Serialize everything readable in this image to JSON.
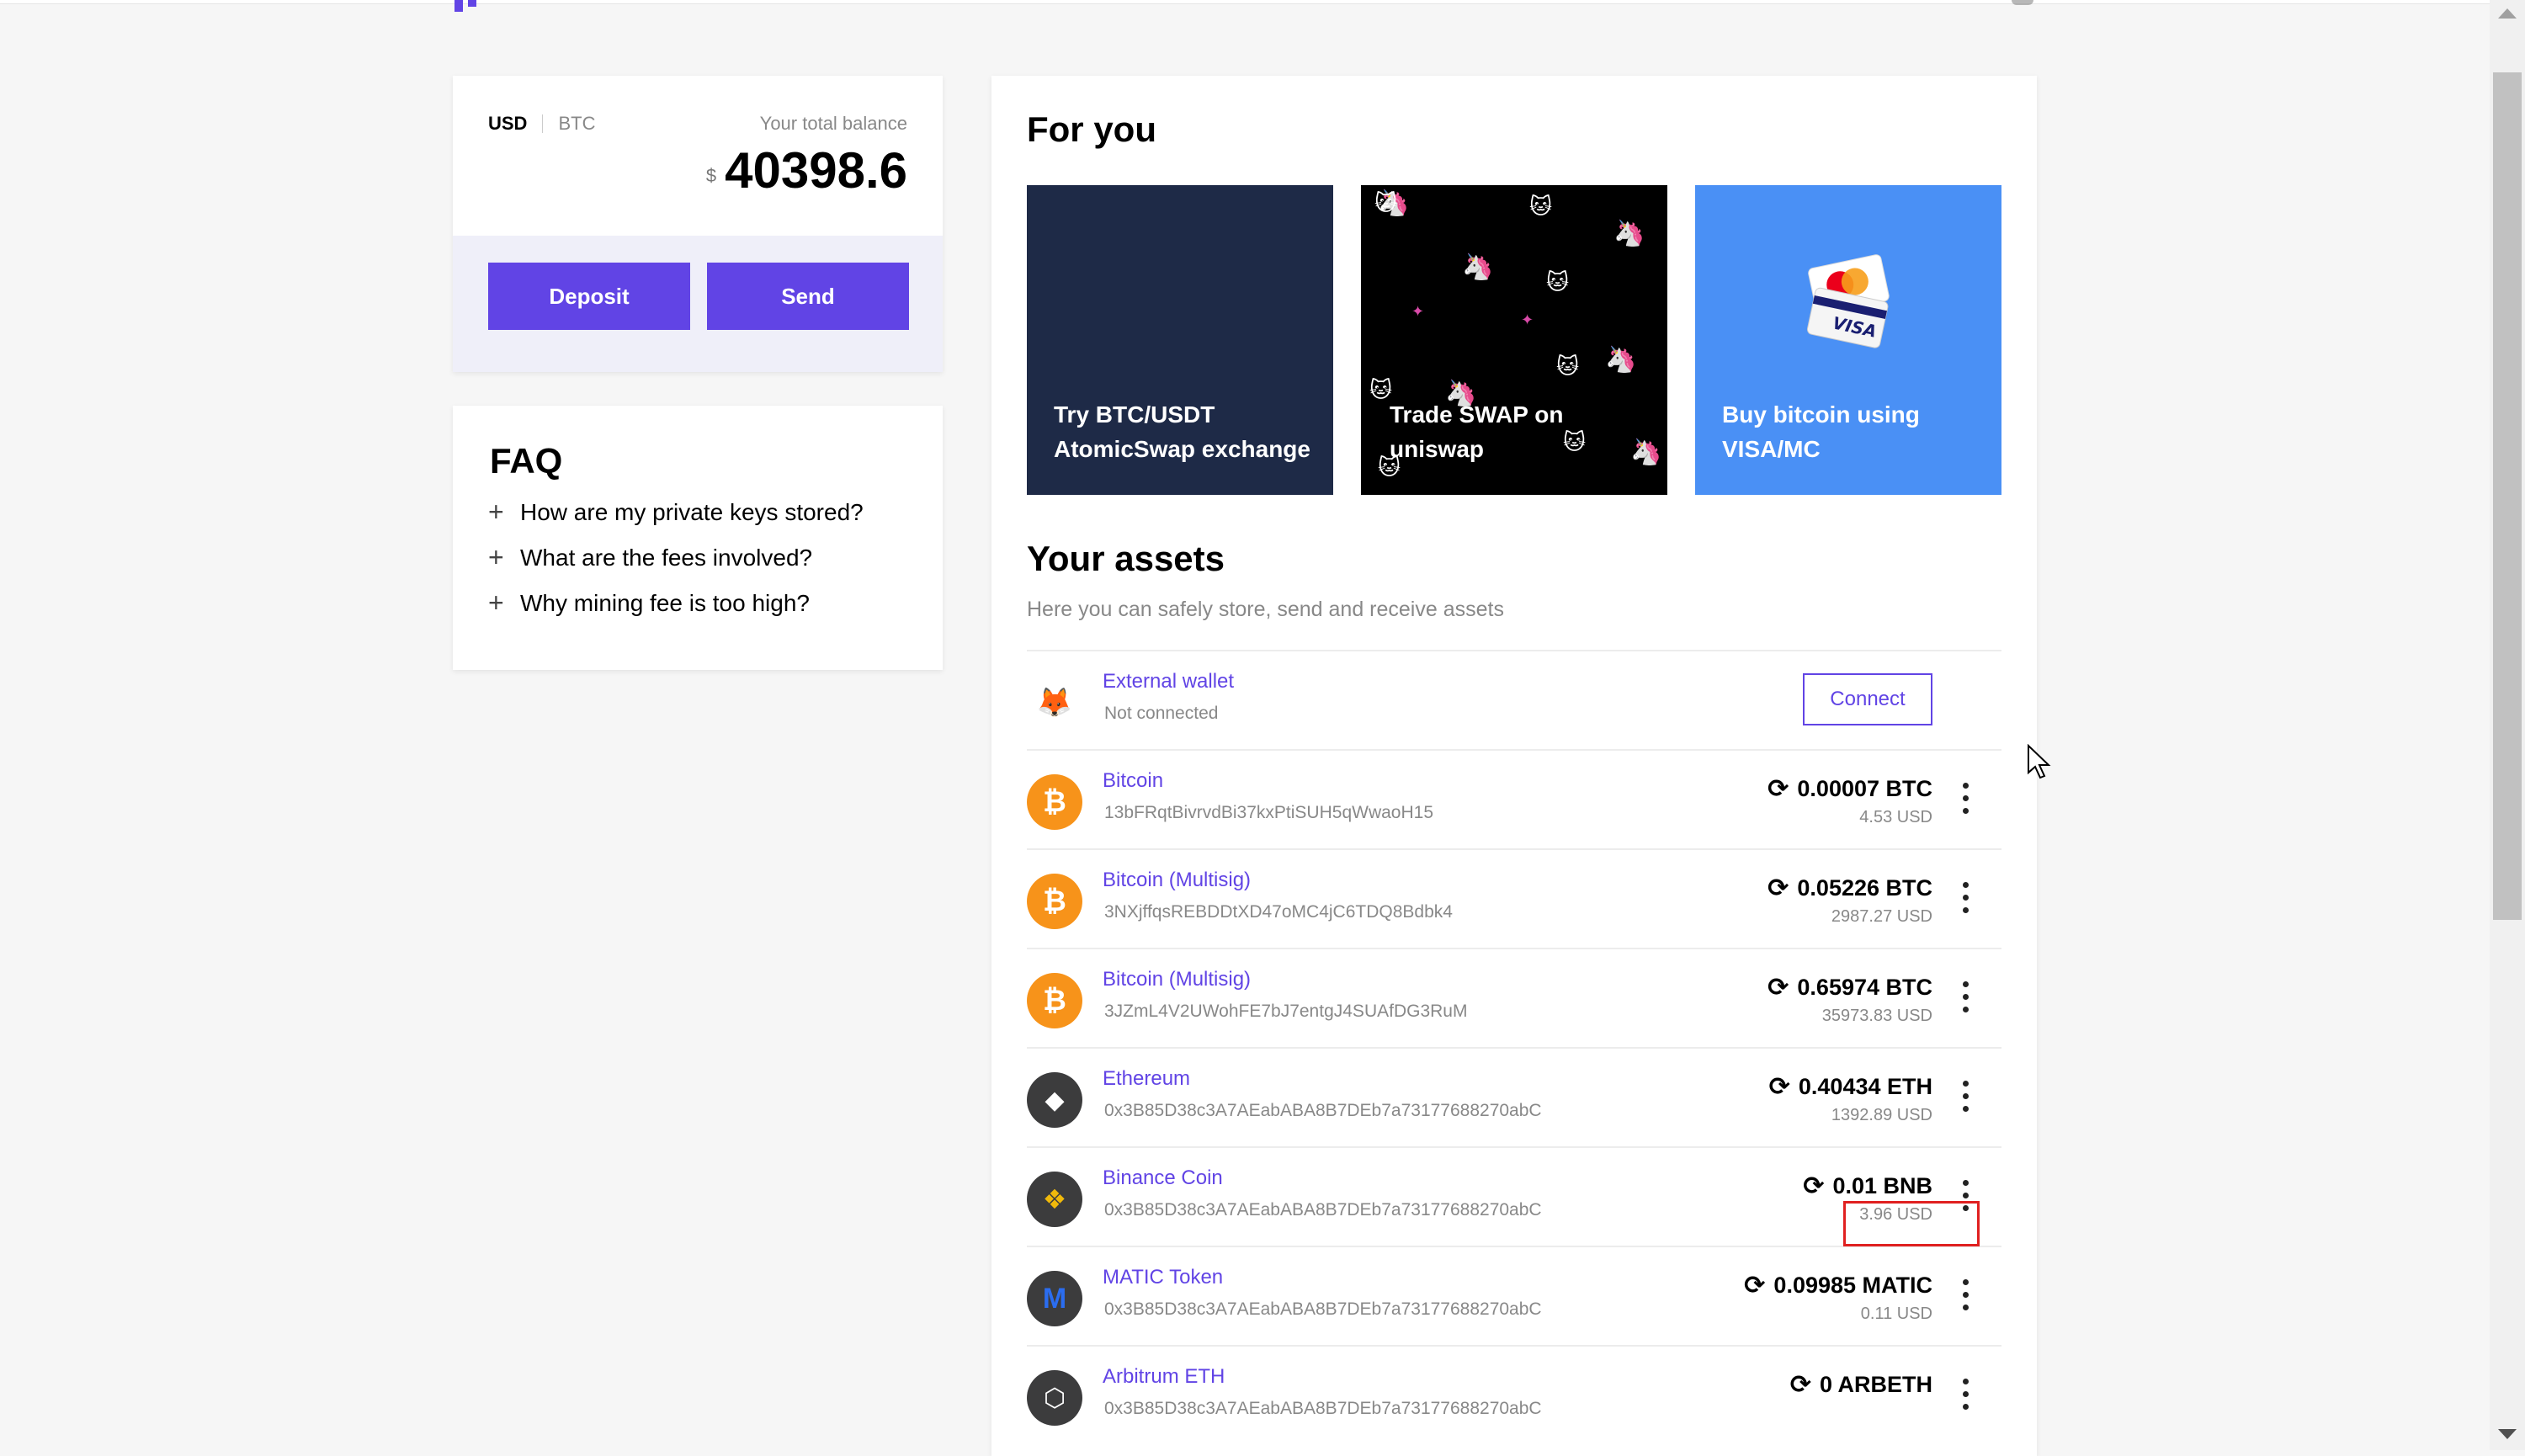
{
  "balance": {
    "currency_usd": "USD",
    "currency_btc": "BTC",
    "label": "Your total balance",
    "symbol": "$",
    "value": "40398.6",
    "deposit_label": "Deposit",
    "send_label": "Send"
  },
  "faq": {
    "title": "FAQ",
    "items": [
      "How are my private keys stored?",
      "What are the fees involved?",
      "Why mining fee is too high?"
    ]
  },
  "for_you": {
    "title": "For you",
    "promos": [
      "Try BTC/USDT AtomicSwap exchange",
      "Trade SWAP on uniswap",
      "Buy bitcoin using VISA/MC"
    ]
  },
  "assets": {
    "title": "Your assets",
    "subtitle": "Here you can safely store, send and receive assets",
    "external_wallet": {
      "name": "External wallet",
      "status": "Not connected",
      "connect_label": "Connect"
    },
    "rows": [
      {
        "name": "Bitcoin",
        "address": "13bFRqtBivrvdBi37kxPtiSUH5qWwaoH15",
        "amount": "0.00007 BTC",
        "usd": "4.53 USD",
        "icon": "bitcoin-icon",
        "color": "#f7931a"
      },
      {
        "name": "Bitcoin (Multisig)",
        "address": "3NXjffqsREBDDtXD47oMC4jC6TDQ8Bdbk4",
        "amount": "0.05226 BTC",
        "usd": "2987.27 USD",
        "icon": "bitcoin-icon",
        "color": "#f7931a"
      },
      {
        "name": "Bitcoin (Multisig)",
        "address": "3JZmL4V2UWohFE7bJ7entgJ4SUAfDG3RuM",
        "amount": "0.65974 BTC",
        "usd": "35973.83 USD",
        "icon": "bitcoin-icon",
        "color": "#f7931a"
      },
      {
        "name": "Ethereum",
        "address": "0x3B85D38c3A7AEabABA8B7DEb7a73177688270abC",
        "amount": "0.40434 ETH",
        "usd": "1392.89 USD",
        "icon": "ethereum-icon",
        "color": "#3c3c3d"
      },
      {
        "name": "Binance Coin",
        "address": "0x3B85D38c3A7AEabABA8B7DEb7a73177688270abC",
        "amount": "0.01 BNB",
        "usd": "3.96 USD",
        "icon": "binance-icon",
        "color": "#3c3c3d"
      },
      {
        "name": "MATIC Token",
        "address": "0x3B85D38c3A7AEabABA8B7DEb7a73177688270abC",
        "amount": "0.09985 MATIC",
        "usd": "0.11 USD",
        "icon": "matic-icon",
        "color": "#3c3c3d"
      },
      {
        "name": "Arbitrum ETH",
        "address": "0x3B85D38c3A7AEabABA8B7DEb7a73177688270abC",
        "amount": "0 ARBETH",
        "usd": "",
        "icon": "arbitrum-icon",
        "color": "#3c3c3d"
      }
    ]
  },
  "colors": {
    "accent": "#6144e5",
    "highlight": "#e02020"
  }
}
